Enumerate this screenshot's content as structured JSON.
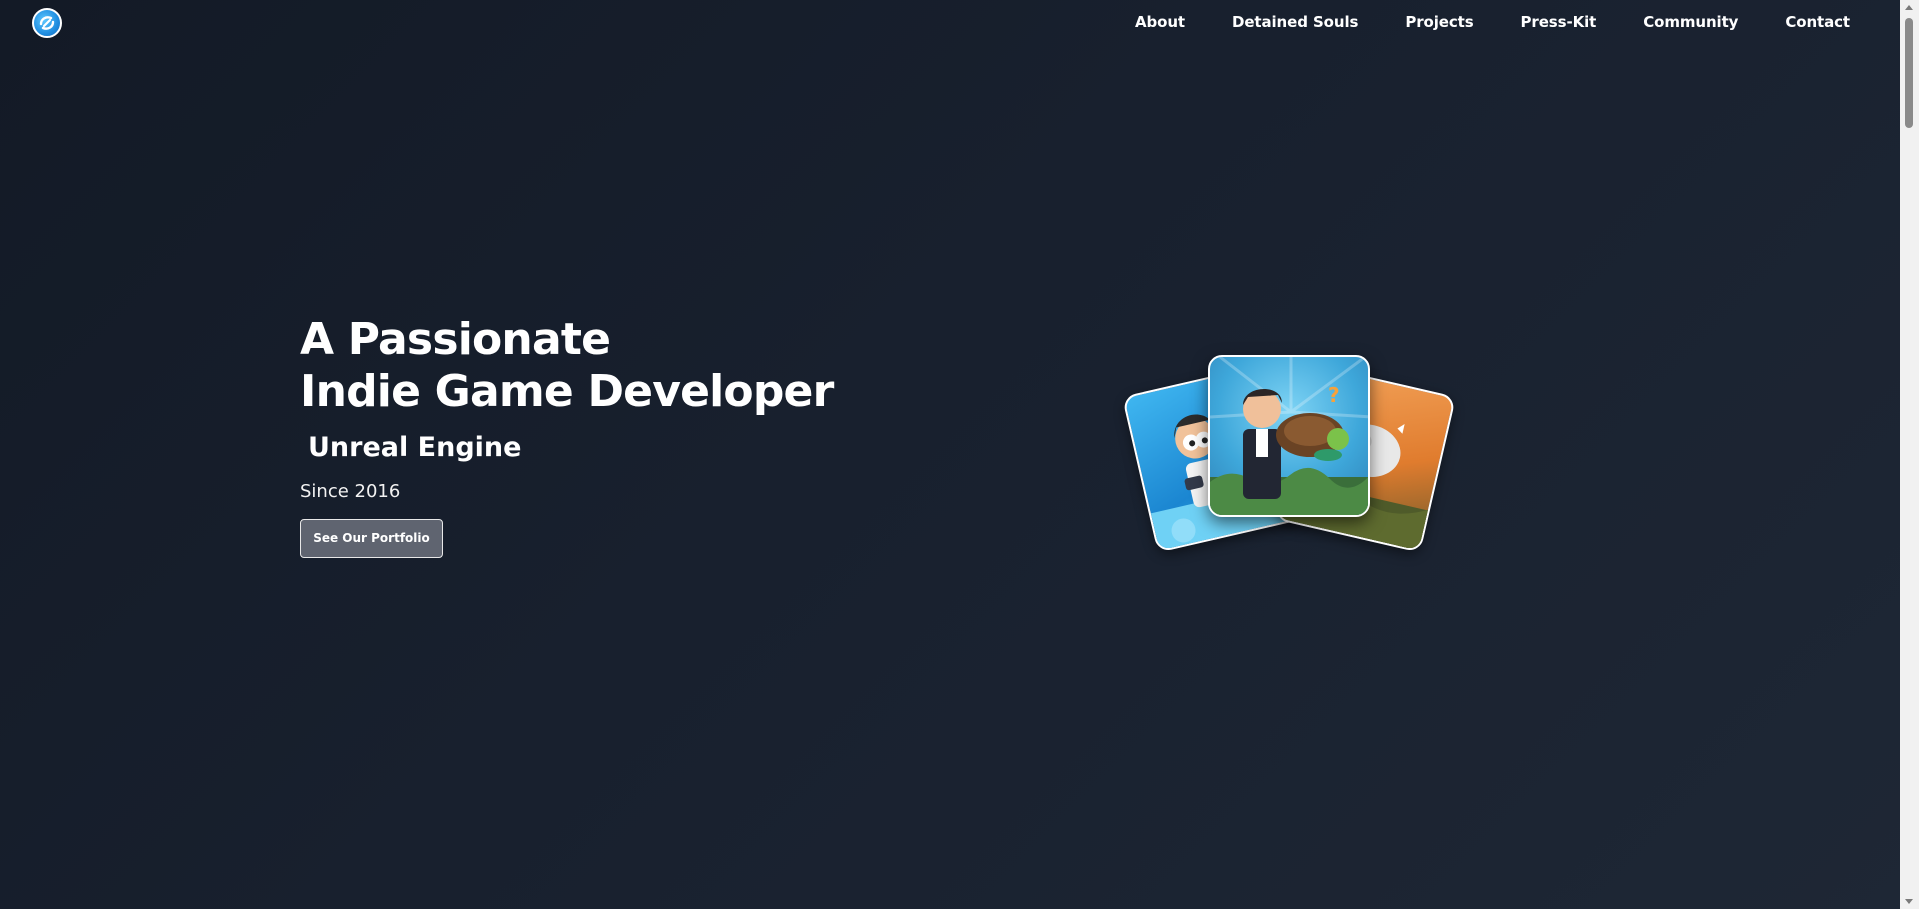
{
  "header": {
    "logo_icon": "studio-logo-icon",
    "nav": [
      {
        "label": "About"
      },
      {
        "label": "Detained Souls"
      },
      {
        "label": "Projects"
      },
      {
        "label": "Press-Kit"
      },
      {
        "label": "Community"
      },
      {
        "label": "Contact"
      }
    ]
  },
  "hero": {
    "title_line1": "A Passionate",
    "title_line2": "Indie Game Developer",
    "subtitle": "Unreal Engine",
    "since": "Since 2016",
    "cta_label": "See Our Portfolio"
  },
  "illustration": {
    "icon": "game-cards-illustration",
    "cards": [
      "left-card",
      "center-card",
      "right-card"
    ]
  },
  "colors": {
    "background": "#18202e",
    "button_bg": "#5f6470",
    "text": "#ffffff"
  }
}
